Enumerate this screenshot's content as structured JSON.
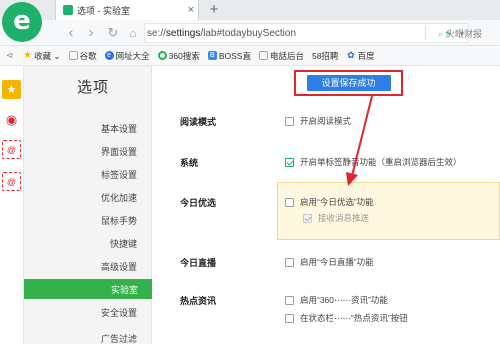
{
  "browser": {
    "tab_title": "选项 - 实验室",
    "tab_close": "×",
    "new_tab": "+",
    "address_prefix": "se://",
    "address_bold": "settings",
    "address_suffix": "/lab#todaybuySection",
    "search_hint": "火眼财报",
    "nav": {
      "back": "‹",
      "forward": "›",
      "refresh": "↻",
      "home": "⌂"
    }
  },
  "bookmarks": [
    {
      "label": "收藏 ⌄",
      "icon": "star-icon",
      "color": "#f5b400"
    },
    {
      "label": "谷歌",
      "icon": "page-icon",
      "color": "#9aa0a6"
    },
    {
      "label": "网址大全",
      "icon": "globe-icon",
      "color": "#2d6df6"
    },
    {
      "label": "360搜索",
      "icon": "360-icon",
      "color": "#2bb24c"
    },
    {
      "label": "BOSS直",
      "icon": "boss-icon",
      "color": "#3a8de6"
    },
    {
      "label": "电話后台",
      "icon": "page-icon",
      "color": "#9aa0a6"
    },
    {
      "label": "58招聘",
      "icon": "58-icon",
      "color": "#f36f21"
    },
    {
      "label": "百度",
      "icon": "baidu-icon",
      "color": "#2e63e6"
    }
  ],
  "settings_nav": {
    "title": "选项",
    "items": [
      "基本设置",
      "界面设置",
      "标签设置",
      "优化加速",
      "鼠标手势",
      "快捷键",
      "高级设置",
      "实验室",
      "安全设置",
      "广告过滤"
    ],
    "active": "实验室"
  },
  "toast": {
    "text": "设置保存成功"
  },
  "sections": {
    "reading": {
      "label": "阅读模式",
      "option": "开启阅读模式",
      "checked": false
    },
    "system": {
      "label": "系统",
      "option": "开启单标签静音功能（重启浏览器后生效）",
      "checked": true
    },
    "today": {
      "label": "今日优选",
      "option": "启用“今日优选”功能",
      "checked": false,
      "sub_option": "接收消息推送",
      "sub_checked": true
    },
    "live": {
      "label": "今日直播",
      "option": "启用“今日直播”功能",
      "checked": false
    },
    "news": {
      "label": "热点资讯",
      "option1": "启用“360⋯⋯资讯”功能",
      "option2": "在状态栏⋯⋯“热点资讯”按钮"
    }
  },
  "colors": {
    "accent_green": "#34b14a",
    "toast_blue": "#2e7ee8",
    "annotation_red": "#e0262a"
  }
}
